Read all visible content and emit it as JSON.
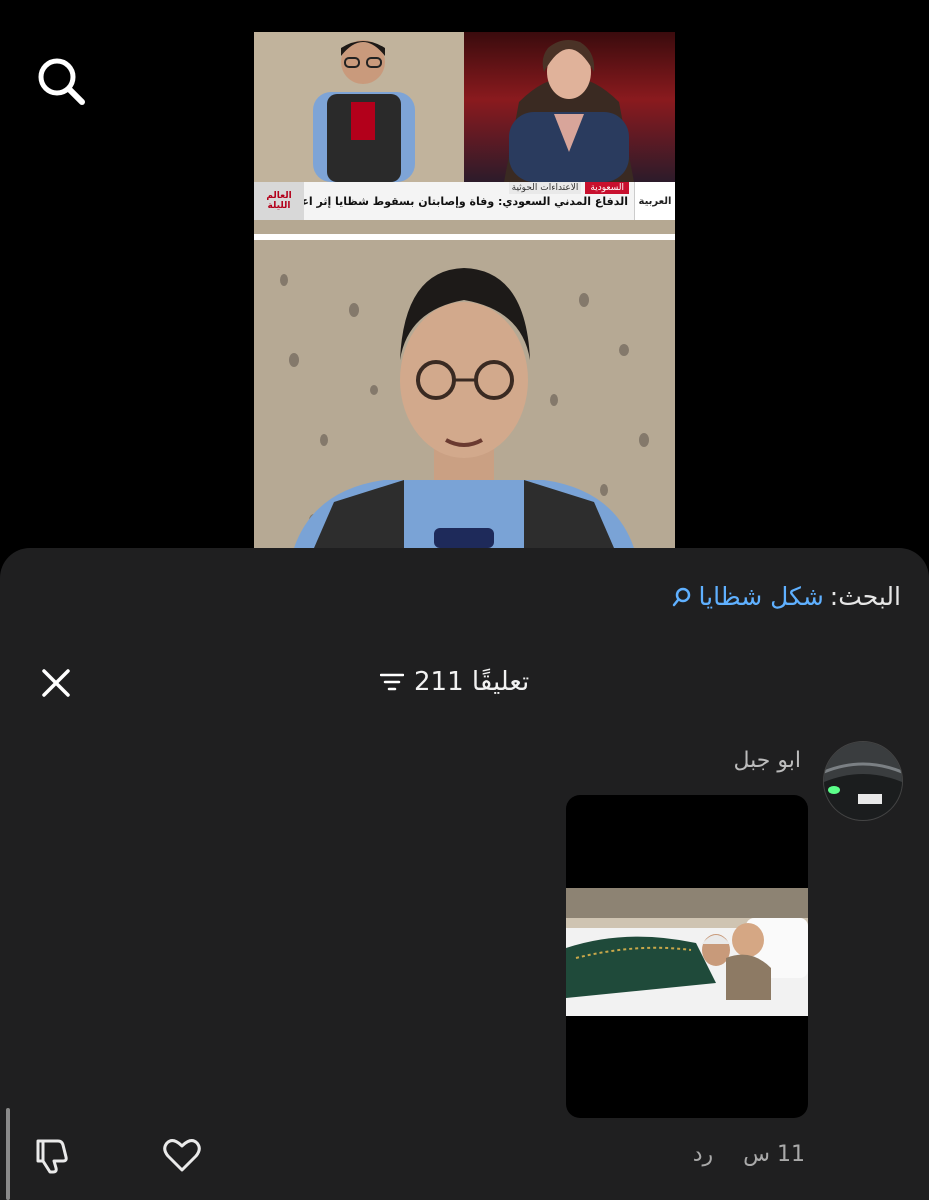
{
  "search": {
    "label": "البحث:",
    "query": "شكل شظايا"
  },
  "video": {
    "ticker_headline": "الدفاع المدني السعودي: وفاة وإصابتان بسقوط شظايا إثر اعتراض مسيرة في الطائف",
    "tag_country": "السعودية",
    "tag_topic": "الاعتداءات الحوثية",
    "channel_logo": "العربية",
    "program_logo": "العالم الليلة"
  },
  "comments": {
    "count_label": "211 تعليقًا"
  },
  "comment": {
    "author": "ابو جبل",
    "time": "11 س",
    "reply_label": "رد"
  },
  "icons": {
    "search": "search-icon",
    "close": "close-icon",
    "filter": "filter-icon",
    "dislike": "thumbs-down-icon",
    "like": "heart-icon"
  }
}
